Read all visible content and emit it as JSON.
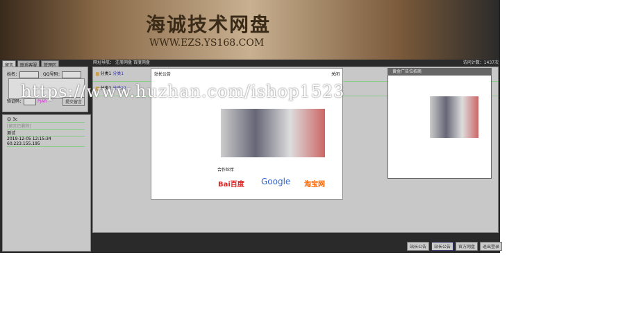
{
  "banner": {
    "title": "海诚技术网盘",
    "url": "WWW.EZS.YS168.COM"
  },
  "tabs": [
    "留言",
    "联系客服",
    "管理区"
  ],
  "form": {
    "name_label": "姓名：",
    "qq_label": "QQ号码：",
    "captcha_label": "验证码：",
    "captcha": "PJAR",
    "submit": "提交留言"
  },
  "messages": {
    "user": "3c",
    "note": "[留言已删除]",
    "text": "测试",
    "meta": "2019-12-05 12:15:34  60.223.155.195"
  },
  "nav": {
    "label": "网址导航：",
    "links": [
      "注册网盘",
      "百度网盘"
    ],
    "counter": "访问计数：1437次"
  },
  "folders": [
    {
      "name": "分类1",
      "link": "分类1"
    },
    {
      "name": "分类2",
      "link": "分类22"
    }
  ],
  "modal": {
    "title": "站长公告",
    "close": "关闭",
    "partners_label": "合作伙伴",
    "partners": [
      "Bai百度",
      "Google",
      "淘宝网"
    ]
  },
  "ad": {
    "title": "黄金广告位招商"
  },
  "buttons": [
    "站长公告",
    "站长公告",
    "官方网盘",
    "退出登录"
  ],
  "watermark": "https://www.huzhan.com/ishop1523"
}
